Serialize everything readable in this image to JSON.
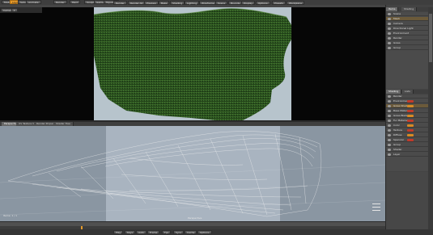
{
  "menubar": {
    "items": [
      "Model",
      "Layout",
      "Setup",
      "Animate",
      "Render",
      "Paint",
      "Sculpt",
      "Game Tools",
      "Topology"
    ],
    "active_index": 1
  },
  "toolbar": {
    "items": [
      "Render",
      "Render All",
      "Preview",
      "Bake",
      "Shading",
      "Lighting",
      "Wireframe",
      "Scene",
      "Bounds",
      "Display",
      "Options",
      "Presets",
      "Workplane"
    ]
  },
  "top_viewport": {
    "label": "Camera",
    "sky_color": "#b7c4cc",
    "grass_color": "#2f5a1f"
  },
  "bottom_tabs": {
    "items": [
      "Perspective",
      "UV Texture View",
      "Render Properties",
      "Shader Tree"
    ],
    "active_index": 0
  },
  "bottom_viewport": {
    "label": "Perspective",
    "corner_text": "Items: 1 / 1",
    "bg_color": "#8a96a2"
  },
  "right_top_panel": {
    "tabs": [
      "Items",
      "Shading"
    ],
    "title": "Items",
    "rows": [
      "Scene",
      "Mesh",
      "Camera",
      "Directional Light",
      "Environment",
      "Render",
      "Grass",
      "Group"
    ]
  },
  "right_bottom_panel": {
    "tabs": [
      "Shading",
      "Lists"
    ],
    "rows": [
      {
        "label": "Render",
        "color": "none"
      },
      {
        "label": "Environment",
        "color": "red"
      },
      {
        "label": "Grass Shader",
        "color": "orange"
      },
      {
        "label": "Base Material",
        "color": "red"
      },
      {
        "label": "Grass Blade",
        "color": "orange"
      },
      {
        "label": "Fur Material",
        "color": "red"
      },
      {
        "label": "Color",
        "color": "orange"
      },
      {
        "label": "Texture",
        "color": "red"
      },
      {
        "label": "Diffuse",
        "color": "orange"
      },
      {
        "label": "Specular",
        "color": "red"
      },
      {
        "label": "Group",
        "color": "none"
      },
      {
        "label": "Shader",
        "color": "none"
      },
      {
        "label": "Layer",
        "color": "none"
      }
    ]
  },
  "timeline": {
    "items": [
      "Play",
      "Keys",
      "Auto",
      "Frame",
      "Fps",
      "Sync",
      "Cache",
      "Options"
    ]
  }
}
